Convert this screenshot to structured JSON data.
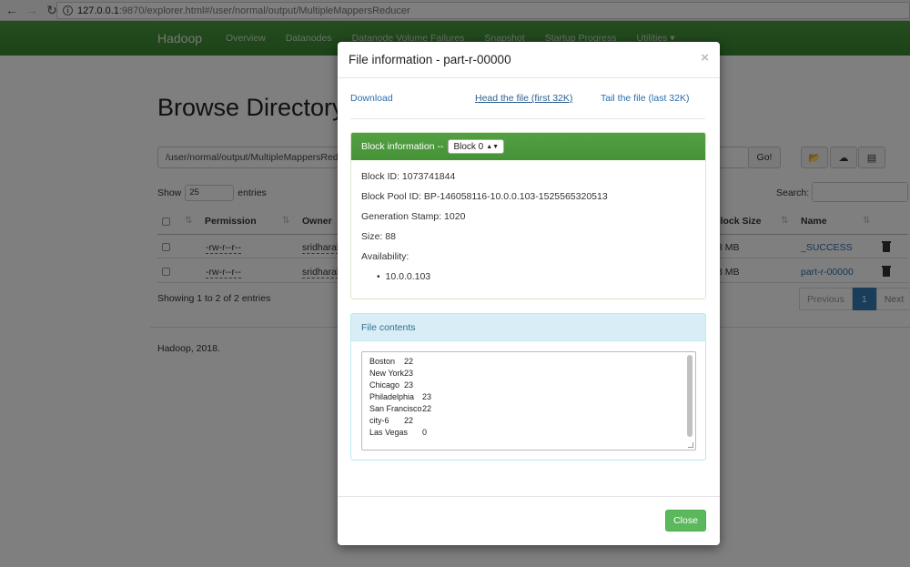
{
  "browser": {
    "url_host": "127.0.0.1",
    "url_rest": ":9870/explorer.html#/user/normal/output/MultipleMappersReducer"
  },
  "navbar": {
    "brand": "Hadoop",
    "links": [
      "Overview",
      "Datanodes",
      "Datanode Volume Failures",
      "Snapshot",
      "Startup Progress",
      "Utilities ▾"
    ]
  },
  "page": {
    "title": "Browse Directory",
    "directory_value": "/user/normal/output/MultipleMappersReducer",
    "go_label": "Go!",
    "show_label": "Show",
    "show_value": "25",
    "entries_label": "entries",
    "search_label": "Search:",
    "columns": [
      "Permission",
      "Owner",
      "Block Size",
      "Name"
    ],
    "rows": [
      {
        "permission": "-rw-r--r--",
        "owner": "sridharal",
        "block_size": "8 MB",
        "name": "_SUCCESS"
      },
      {
        "permission": "-rw-r--r--",
        "owner": "sridharal",
        "block_size": "8 MB",
        "name": "part-r-00000"
      }
    ],
    "showing_text": "Showing 1 to 2 of 2 entries",
    "pager": {
      "previous": "Previous",
      "current": "1",
      "next": "Next"
    },
    "footer": "Hadoop, 2018."
  },
  "modal": {
    "title": "File information - part-r-00000",
    "close_x": "×",
    "download_label": "Download",
    "head_label": "Head the file (first 32K)",
    "tail_label": "Tail the file (last 32K)",
    "block_info_label": "Block information --",
    "block_select_value": "Block 0",
    "block_id": "Block ID: 1073741844",
    "block_pool_id": "Block Pool ID: BP-146058116-10.0.0.103-1525565320513",
    "generation_stamp": "Generation Stamp: 1020",
    "size": "Size: 88",
    "availability_label": "Availability:",
    "availability_nodes": [
      "10.0.0.103"
    ],
    "file_contents_label": "File contents",
    "file_lines": [
      {
        "city": "Boston",
        "count": "22"
      },
      {
        "city": "New York",
        "count": "23"
      },
      {
        "city": "Chicago",
        "count": "23"
      },
      {
        "city": "Philadelphia",
        "count": "23"
      },
      {
        "city": "San Francisco",
        "count": "22"
      },
      {
        "city": "city-6",
        "count": "22"
      },
      {
        "city": "Las Vegas",
        "count": "0"
      }
    ],
    "close_label": "Close"
  },
  "colors": {
    "navbar": "#3a8531",
    "success_header": "#4e9a3c",
    "info_header": "#d9edf7",
    "link": "#2a6ead",
    "close_button": "#5cb85c"
  }
}
